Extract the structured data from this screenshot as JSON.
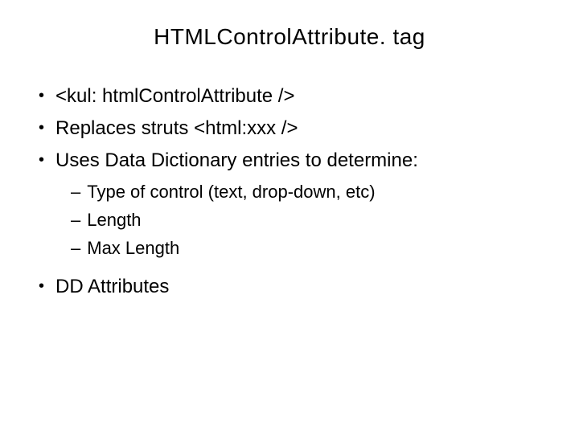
{
  "title": "HTMLControlAttribute. tag",
  "bullets": {
    "b0": "<kul: htmlControlAttribute />",
    "b1": "Replaces struts <html:xxx />",
    "b2": "Uses Data Dictionary entries to determine:",
    "b3": "DD Attributes"
  },
  "subs": {
    "s0": "Type of control (text, drop-down, etc)",
    "s1": "Length",
    "s2": "Max Length"
  }
}
